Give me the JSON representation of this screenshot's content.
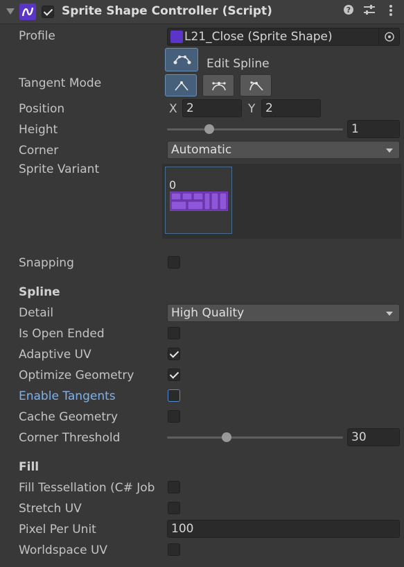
{
  "header": {
    "title": "Sprite Shape Controller (Script)",
    "enabled": true,
    "help_icon": "help-icon",
    "presets_icon": "presets-icon",
    "menu_icon": "kebab-menu-icon"
  },
  "profile": {
    "label": "Profile",
    "value": "L21_Close (Sprite Shape)"
  },
  "edit_spline": {
    "label": "Edit Spline"
  },
  "tangent_mode": {
    "label": "Tangent Mode",
    "modes": [
      "linear",
      "continuous",
      "broken"
    ],
    "selected": "linear"
  },
  "position": {
    "label": "Position",
    "x_label": "X",
    "x": "2",
    "y_label": "Y",
    "y": "2"
  },
  "height": {
    "label": "Height",
    "value": "1",
    "slider_fraction": 0.24
  },
  "corner": {
    "label": "Corner",
    "value": "Automatic"
  },
  "sprite_variant": {
    "label": "Sprite Variant",
    "index": "0"
  },
  "snapping": {
    "label": "Snapping",
    "checked": false
  },
  "spline_section": {
    "title": "Spline"
  },
  "detail": {
    "label": "Detail",
    "value": "High Quality"
  },
  "is_open_ended": {
    "label": "Is Open Ended",
    "checked": false
  },
  "adaptive_uv": {
    "label": "Adaptive UV",
    "checked": true
  },
  "optimize_geometry": {
    "label": "Optimize Geometry",
    "checked": true
  },
  "enable_tangents": {
    "label": "Enable Tangents",
    "checked": false
  },
  "cache_geometry": {
    "label": "Cache Geometry",
    "checked": false
  },
  "corner_threshold": {
    "label": "Corner Threshold",
    "value": "30",
    "slider_fraction": 0.34
  },
  "fill_section": {
    "title": "Fill"
  },
  "fill_tessellation": {
    "label": "Fill Tessellation (C# Job",
    "checked": false
  },
  "stretch_uv": {
    "label": "Stretch UV",
    "checked": false
  },
  "pixel_per_unit": {
    "label": "Pixel Per Unit",
    "value": "100"
  },
  "worldspace_uv": {
    "label": "Worldspace UV",
    "checked": false
  },
  "colors": {
    "accent_blue": "#7fb2ec",
    "panel": "#383838",
    "sprite_purple": "#7a3fc0"
  }
}
